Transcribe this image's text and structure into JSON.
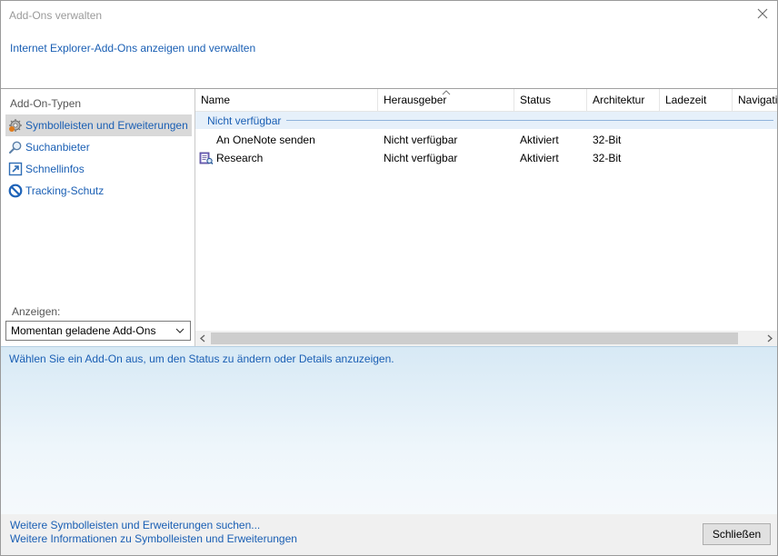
{
  "window": {
    "title": "Add-Ons verwalten",
    "subtitle": "Internet Explorer-Add-Ons anzeigen und verwalten"
  },
  "sidebar": {
    "group_title": "Add-On-Typen",
    "items": [
      {
        "label": "Symbolleisten und Erweiterungen",
        "icon": "gear-icon",
        "selected": true
      },
      {
        "label": "Suchanbieter",
        "icon": "search-icon",
        "selected": false
      },
      {
        "label": "Schnellinfos",
        "icon": "accelerator-icon",
        "selected": false
      },
      {
        "label": "Tracking-Schutz",
        "icon": "no-sign-icon",
        "selected": false
      }
    ],
    "show_label": "Anzeigen:",
    "show_select": "Momentan geladene Add-Ons"
  },
  "list": {
    "columns": [
      "Name",
      "Herausgeber",
      "Status",
      "Architektur",
      "Ladezeit",
      "Navigati"
    ],
    "sorted_column": "Herausgeber",
    "group": "Nicht verfügbar",
    "rows": [
      {
        "name": "An OneNote senden",
        "publisher": "Nicht verfügbar",
        "status": "Aktiviert",
        "arch": "32-Bit",
        "icon": "none"
      },
      {
        "name": "Research",
        "publisher": "Nicht verfügbar",
        "status": "Aktiviert",
        "arch": "32-Bit",
        "icon": "research-book-icon"
      }
    ]
  },
  "details": {
    "message": "Wählen Sie ein Add-On aus, um den Status zu ändern oder Details anzuzeigen."
  },
  "footer": {
    "link1": "Weitere Symbolleisten und Erweiterungen suchen...",
    "link2": "Weitere Informationen zu Symbolleisten und Erweiterungen",
    "close_button": "Schließen"
  },
  "colors": {
    "link": "#1a5fb4",
    "selection": "#d9d9d9",
    "group_band": "#e6f0fa",
    "footer": "#f0f0f0"
  }
}
